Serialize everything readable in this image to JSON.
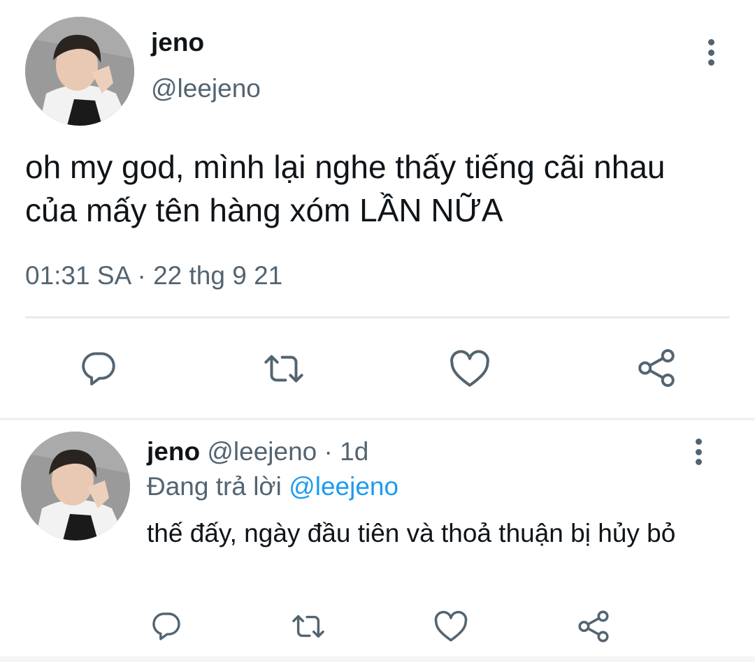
{
  "tweet": {
    "author_name": "jeno",
    "author_handle": "@leejeno",
    "text": "oh my god, mình lại nghe thấy tiếng cãi nhau của mấy tên hàng xóm LẦN NỮA",
    "time": "01:31 SA",
    "separator": "·",
    "date": "22 thg 9 21",
    "actions": [
      "comment-icon",
      "retweet-icon",
      "like-icon",
      "share-icon"
    ]
  },
  "reply": {
    "author_name": "jeno",
    "author_handle": "@leejeno",
    "separator": "·",
    "age": "1d",
    "replying_prefix": "Đang trả lời",
    "replying_to": "@leejeno",
    "text": "thế đấy, ngày đầu tiên và thoả thuận bị hủy bỏ",
    "actions": [
      "comment-icon",
      "retweet-icon",
      "like-icon",
      "share-icon"
    ]
  },
  "colors": {
    "text_primary": "#0f1419",
    "text_secondary": "#536471",
    "link": "#1d9bf0",
    "divider": "#e7eaec"
  }
}
